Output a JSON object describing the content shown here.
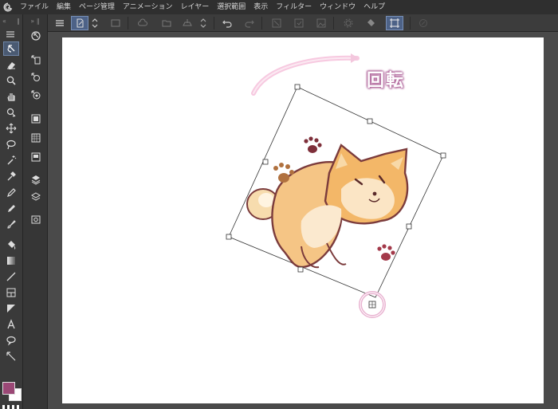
{
  "menu": {
    "items": [
      "ファイル",
      "編集",
      "ページ管理",
      "アニメーション",
      "レイヤー",
      "選択範囲",
      "表示",
      "フィルター",
      "ウィンドウ",
      "ヘルプ"
    ]
  },
  "tools": [
    "operation-tool",
    "eraser-tool",
    "zoom-tool",
    "hand-tool",
    "object-select-tool",
    "move-tool",
    "lasso-tool",
    "magic-wand-tool",
    "eyedropper-tool",
    "pen-tool",
    "pencil-tool",
    "brush-tool",
    "fill-tool",
    "gradient-tool",
    "line-tool",
    "frame-tool",
    "ruler-tool",
    "text-tool",
    "balloon-tool",
    "correct-line-tool"
  ],
  "subtools": [
    "object-subtool",
    "layer-select-subtool",
    "layer-move-subtool",
    "rotate-subtool",
    "layer-panel-icon",
    "material-icon",
    "navigator-icon",
    "layer-stack-icon",
    "layer-property-icon",
    "capture-icon"
  ],
  "colors": {
    "foreground": "#9b4876",
    "background": "#ffffff",
    "accent": "#6f86a8",
    "label_glow": "#b46ea0"
  },
  "canvas": {
    "annotation_label": "回転"
  }
}
